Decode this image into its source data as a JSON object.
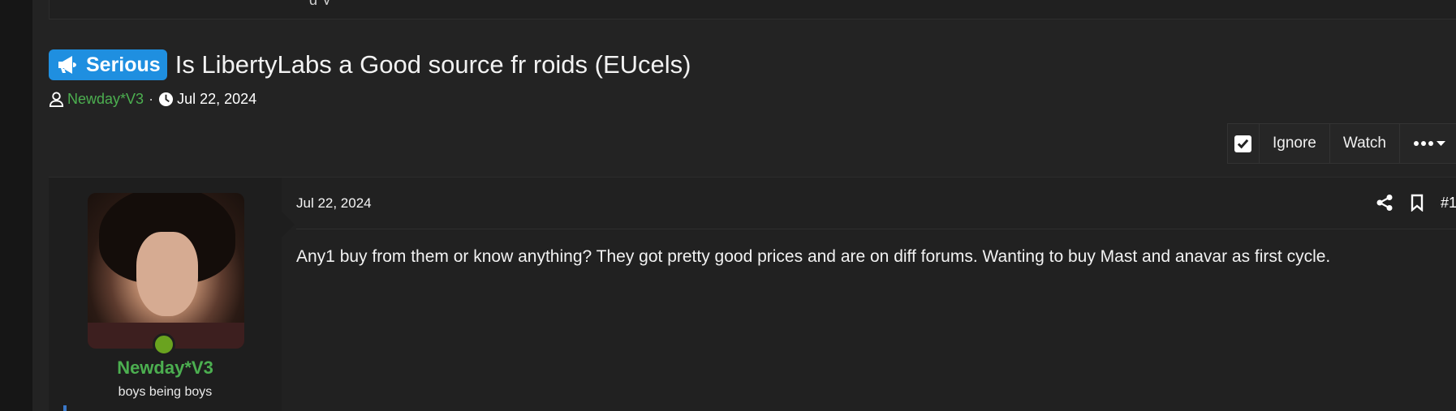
{
  "top_strip": {
    "cut_text": "g y"
  },
  "thread": {
    "prefix": {
      "label": "Serious",
      "color": "#1f8fe0",
      "icon": "megaphone-icon"
    },
    "title": "Is LibertyLabs a Good source fr roids (EUcels)",
    "author": "Newday*V3",
    "separator": "·",
    "date": "Jul 22, 2024"
  },
  "toolbar": {
    "ignore_label": "Ignore",
    "watch_label": "Watch"
  },
  "post": {
    "date": "Jul 22, 2024",
    "number": "#1",
    "body": "Any1 buy from them or know anything? They got pretty good prices and are on diff forums. Wanting to buy Mast and anavar as first cycle.",
    "user": {
      "name": "Newday*V3",
      "title": "boys being boys",
      "online": true
    }
  },
  "colors": {
    "accent": "#1f8fe0",
    "username": "#4caf50",
    "online": "#6aa31f",
    "background": "#232323"
  }
}
